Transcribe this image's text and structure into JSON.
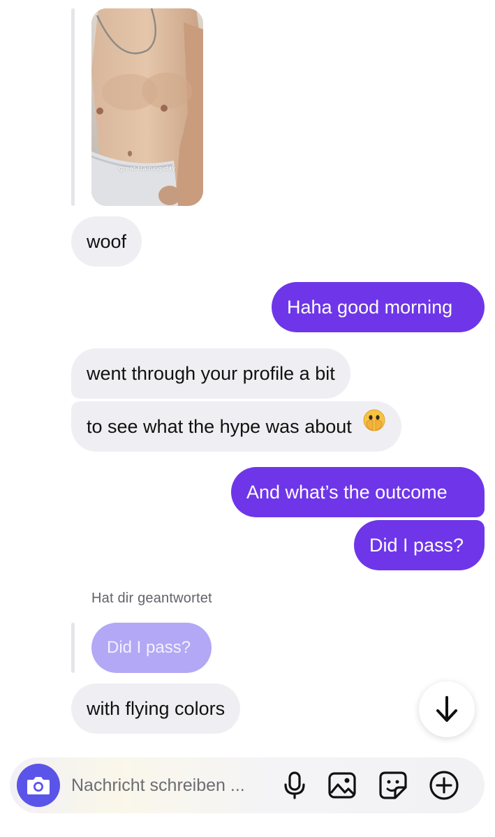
{
  "shared_post": {
    "caption": "great training day"
  },
  "messages": [
    {
      "side": "in",
      "text": "woof"
    },
    {
      "side": "out",
      "text": "Haha good morning"
    },
    {
      "side": "in",
      "text": "went through your profile a bit"
    },
    {
      "side": "in",
      "text": "to see what the hype was about",
      "emoji": "face-with-hand-over-mouth-emoji"
    },
    {
      "side": "out",
      "text": "And what’s the outcome"
    },
    {
      "side": "out",
      "text": "Did I pass?"
    }
  ],
  "reply": {
    "label": "Hat dir geantwortet",
    "quoted_text": "Did I pass?",
    "text": "with flying colors"
  },
  "composer": {
    "placeholder": "Nachricht schreiben ...",
    "icons": [
      "camera-icon",
      "microphone-icon",
      "gallery-icon",
      "sticker-icon",
      "plus-icon"
    ]
  },
  "scroll_button_icon": "arrow-down-icon",
  "colors": {
    "outgoing_bubble": "#6e36e8",
    "incoming_bubble": "#efeff3",
    "quoted_bubble": "#b3a8f5",
    "camera_button": "#5b54e8"
  }
}
